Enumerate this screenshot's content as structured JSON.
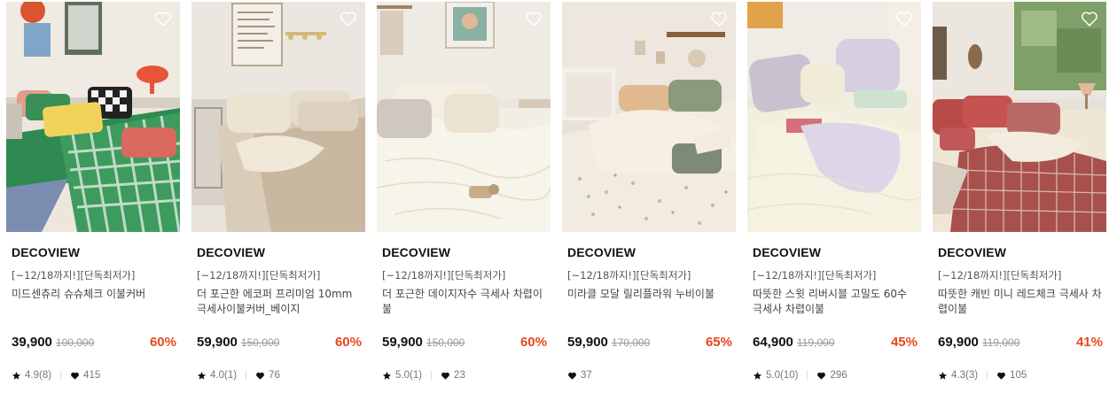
{
  "products": [
    {
      "brand": "DECOVIEW",
      "tag": "[~12/18까지!][단독최저가]",
      "name": "미드센츄리 슈슈체크 이불커버",
      "price": "39,900",
      "original_price": "100,000",
      "discount": "60%",
      "rating": "4.9(8)",
      "likes": "415",
      "image": "green-gingham-bedding-photo"
    },
    {
      "brand": "DECOVIEW",
      "tag": "[~12/18까지!][단독최저가]",
      "name": "더 포근한 에코퍼 프리미엄 10mm 극세사이불커버_베이지",
      "price": "59,900",
      "original_price": "150,000",
      "discount": "60%",
      "rating": "4.0(1)",
      "likes": "76",
      "image": "beige-bedding-photo"
    },
    {
      "brand": "DECOVIEW",
      "tag": "[~12/18까지!][단독최저가]",
      "name": "더 포근한 데이지자수 극세사 차렵이불",
      "price": "59,900",
      "original_price": "150,000",
      "discount": "60%",
      "rating": "5.0(1)",
      "likes": "23",
      "image": "cream-daisy-bedding-photo"
    },
    {
      "brand": "DECOVIEW",
      "tag": "[~12/18까지!][단독최저가]",
      "name": "미라클 모달 릴리플라워 누비이불",
      "price": "59,900",
      "original_price": "170,000",
      "discount": "65%",
      "rating": "",
      "likes": "37",
      "image": "floral-quilt-photo"
    },
    {
      "brand": "DECOVIEW",
      "tag": "[~12/18까지!][단독최저가]",
      "name": "따뜻한 스윗 리버시블 고밀도 60수 극세사 차렵이불",
      "price": "64,900",
      "original_price": "119,000",
      "discount": "45%",
      "rating": "5.0(10)",
      "likes": "296",
      "image": "lavender-cream-bedding-photo"
    },
    {
      "brand": "DECOVIEW",
      "tag": "[~12/18까지!][단독최저가]",
      "name": "따뜻한 캐빈 미니 레드체크 극세사 차렵이불",
      "price": "69,900",
      "original_price": "119,000",
      "discount": "41%",
      "rating": "4.3(3)",
      "likes": "105",
      "image": "red-check-bedding-photo"
    }
  ],
  "icons": {
    "wishlist": "heart-outline-icon",
    "rating": "star-icon",
    "likes": "heart-filled-icon"
  },
  "colors": {
    "discount": "#e8471e",
    "price": "#111111",
    "muted": "#999999"
  }
}
